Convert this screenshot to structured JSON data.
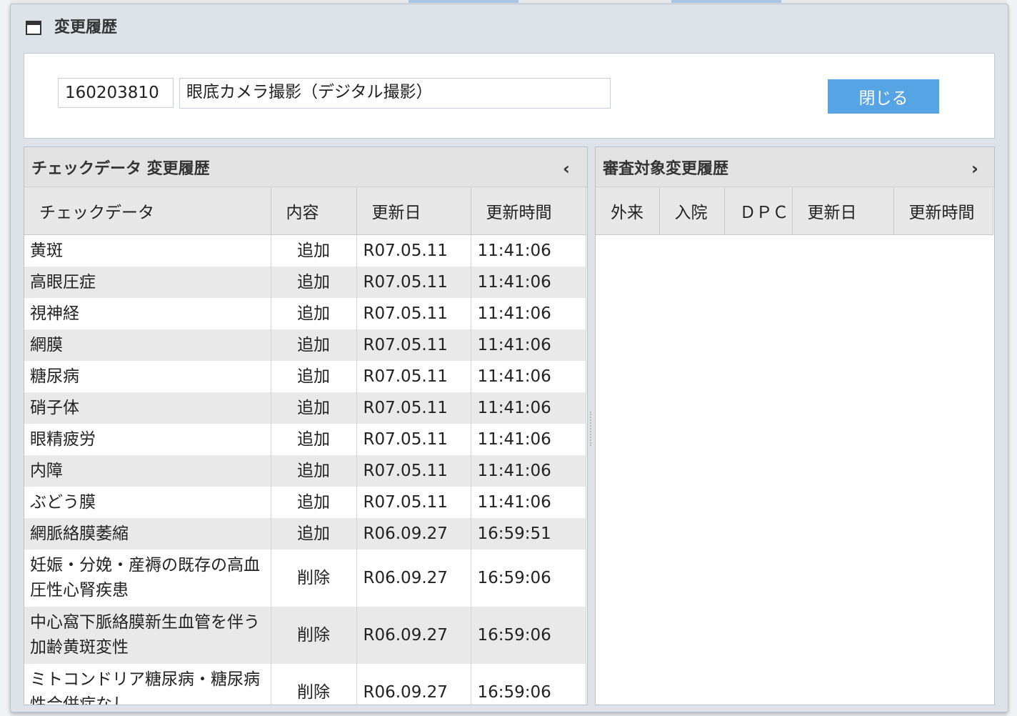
{
  "dialog": {
    "title": "変更履歴",
    "code": "160203810",
    "name": "眼底カメラ撮影（デジタル撮影）",
    "close_label": "閉じる"
  },
  "left_panel": {
    "title": "チェックデータ 変更履歴",
    "collapse_icon": "chevron-left-icon",
    "columns": [
      "チェックデータ",
      "内容",
      "更新日",
      "更新時間"
    ],
    "rows": [
      {
        "item": "黄斑",
        "content": "追加",
        "date": "R07.05.11",
        "time": "11:41:06"
      },
      {
        "item": "高眼圧症",
        "content": "追加",
        "date": "R07.05.11",
        "time": "11:41:06"
      },
      {
        "item": "視神経",
        "content": "追加",
        "date": "R07.05.11",
        "time": "11:41:06"
      },
      {
        "item": "網膜",
        "content": "追加",
        "date": "R07.05.11",
        "time": "11:41:06"
      },
      {
        "item": "糖尿病",
        "content": "追加",
        "date": "R07.05.11",
        "time": "11:41:06"
      },
      {
        "item": "硝子体",
        "content": "追加",
        "date": "R07.05.11",
        "time": "11:41:06"
      },
      {
        "item": "眼精疲労",
        "content": "追加",
        "date": "R07.05.11",
        "time": "11:41:06"
      },
      {
        "item": "内障",
        "content": "追加",
        "date": "R07.05.11",
        "time": "11:41:06"
      },
      {
        "item": "ぶどう膜",
        "content": "追加",
        "date": "R07.05.11",
        "time": "11:41:06"
      },
      {
        "item": "網脈絡膜萎縮",
        "content": "追加",
        "date": "R06.09.27",
        "time": "16:59:51"
      },
      {
        "item": "妊娠・分娩・産褥の既存の高血圧性心腎疾患",
        "content": "削除",
        "date": "R06.09.27",
        "time": "16:59:06"
      },
      {
        "item": "中心窩下脈絡膜新生血管を伴う加齢黄斑変性",
        "content": "削除",
        "date": "R06.09.27",
        "time": "16:59:06"
      },
      {
        "item": "ミトコンドリア糖尿病・糖尿病性合併症なし",
        "content": "削除",
        "date": "R06.09.27",
        "time": "16:59:06"
      }
    ]
  },
  "right_panel": {
    "title": "審査対象変更履歴",
    "expand_icon": "chevron-right-icon",
    "columns": [
      "外来",
      "入院",
      "ＤＰＣ",
      "更新日",
      "更新時間"
    ]
  }
}
